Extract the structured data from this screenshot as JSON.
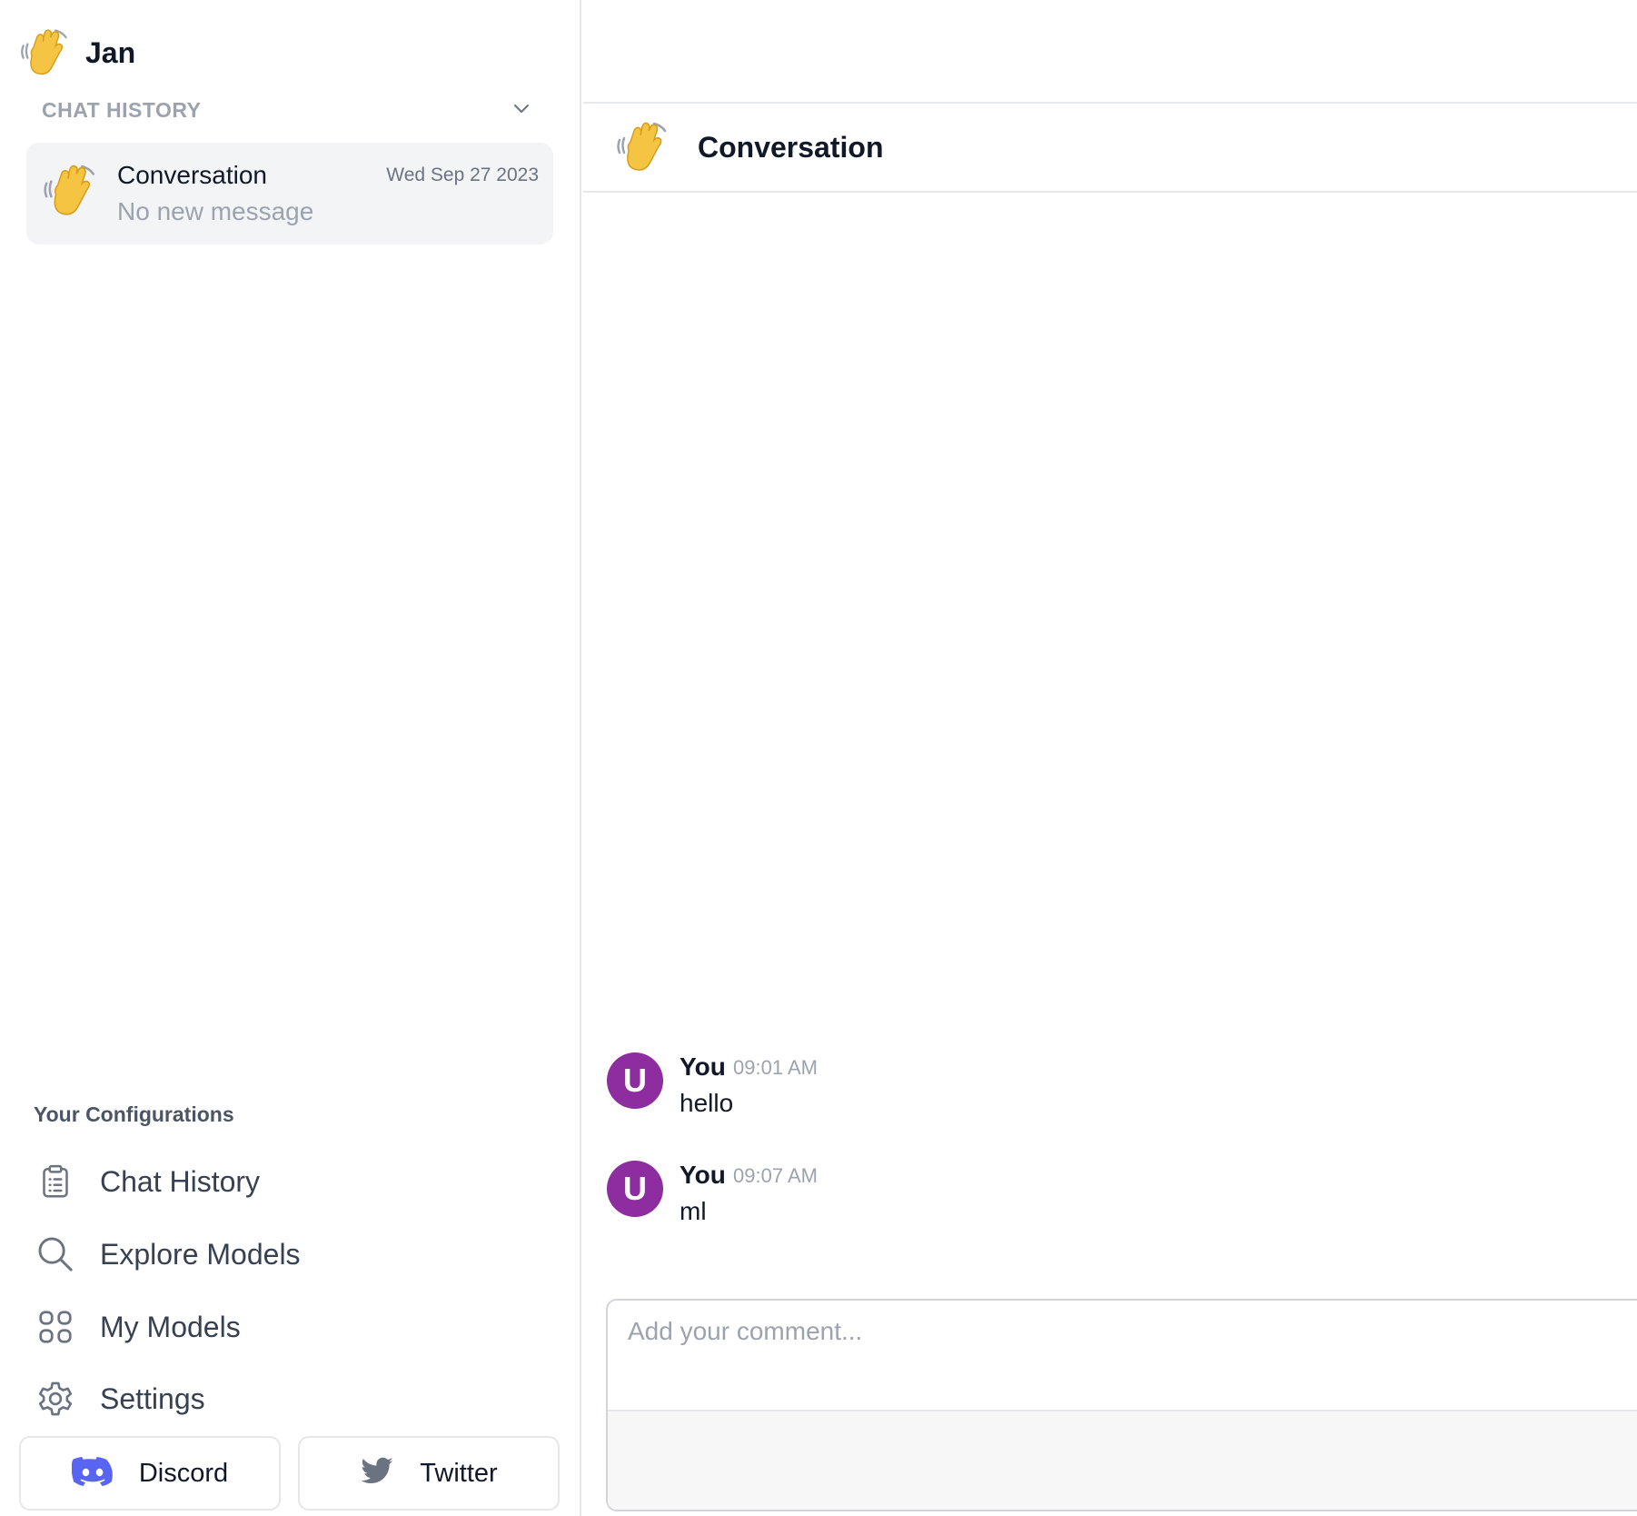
{
  "app": {
    "name": "Jan"
  },
  "sidebar": {
    "history_title": "CHAT HISTORY",
    "conversation": {
      "title": "Conversation",
      "date": "Wed Sep 27 2023",
      "subtitle": "No new message"
    },
    "config_title": "Your Configurations",
    "nav": [
      {
        "label": "Chat History",
        "icon": "clipboard-list-icon"
      },
      {
        "label": "Explore Models",
        "icon": "search-icon"
      },
      {
        "label": "My Models",
        "icon": "grid-icon"
      },
      {
        "label": "Settings",
        "icon": "gear-icon"
      }
    ],
    "social": [
      {
        "label": "Discord",
        "icon": "discord-icon",
        "color": "#5865F2"
      },
      {
        "label": "Twitter",
        "icon": "twitter-icon",
        "color": "#6b7280"
      }
    ]
  },
  "main": {
    "title": "Conversation",
    "messages": [
      {
        "avatar": "U",
        "author": "You",
        "time": "09:01 AM",
        "text": "hello"
      },
      {
        "avatar": "U",
        "author": "You",
        "time": "09:07 AM",
        "text": "ml"
      }
    ],
    "composer": {
      "placeholder": "Add your comment..."
    }
  },
  "colors": {
    "avatar": "#8e2d9f",
    "wave": "#f6c443"
  }
}
